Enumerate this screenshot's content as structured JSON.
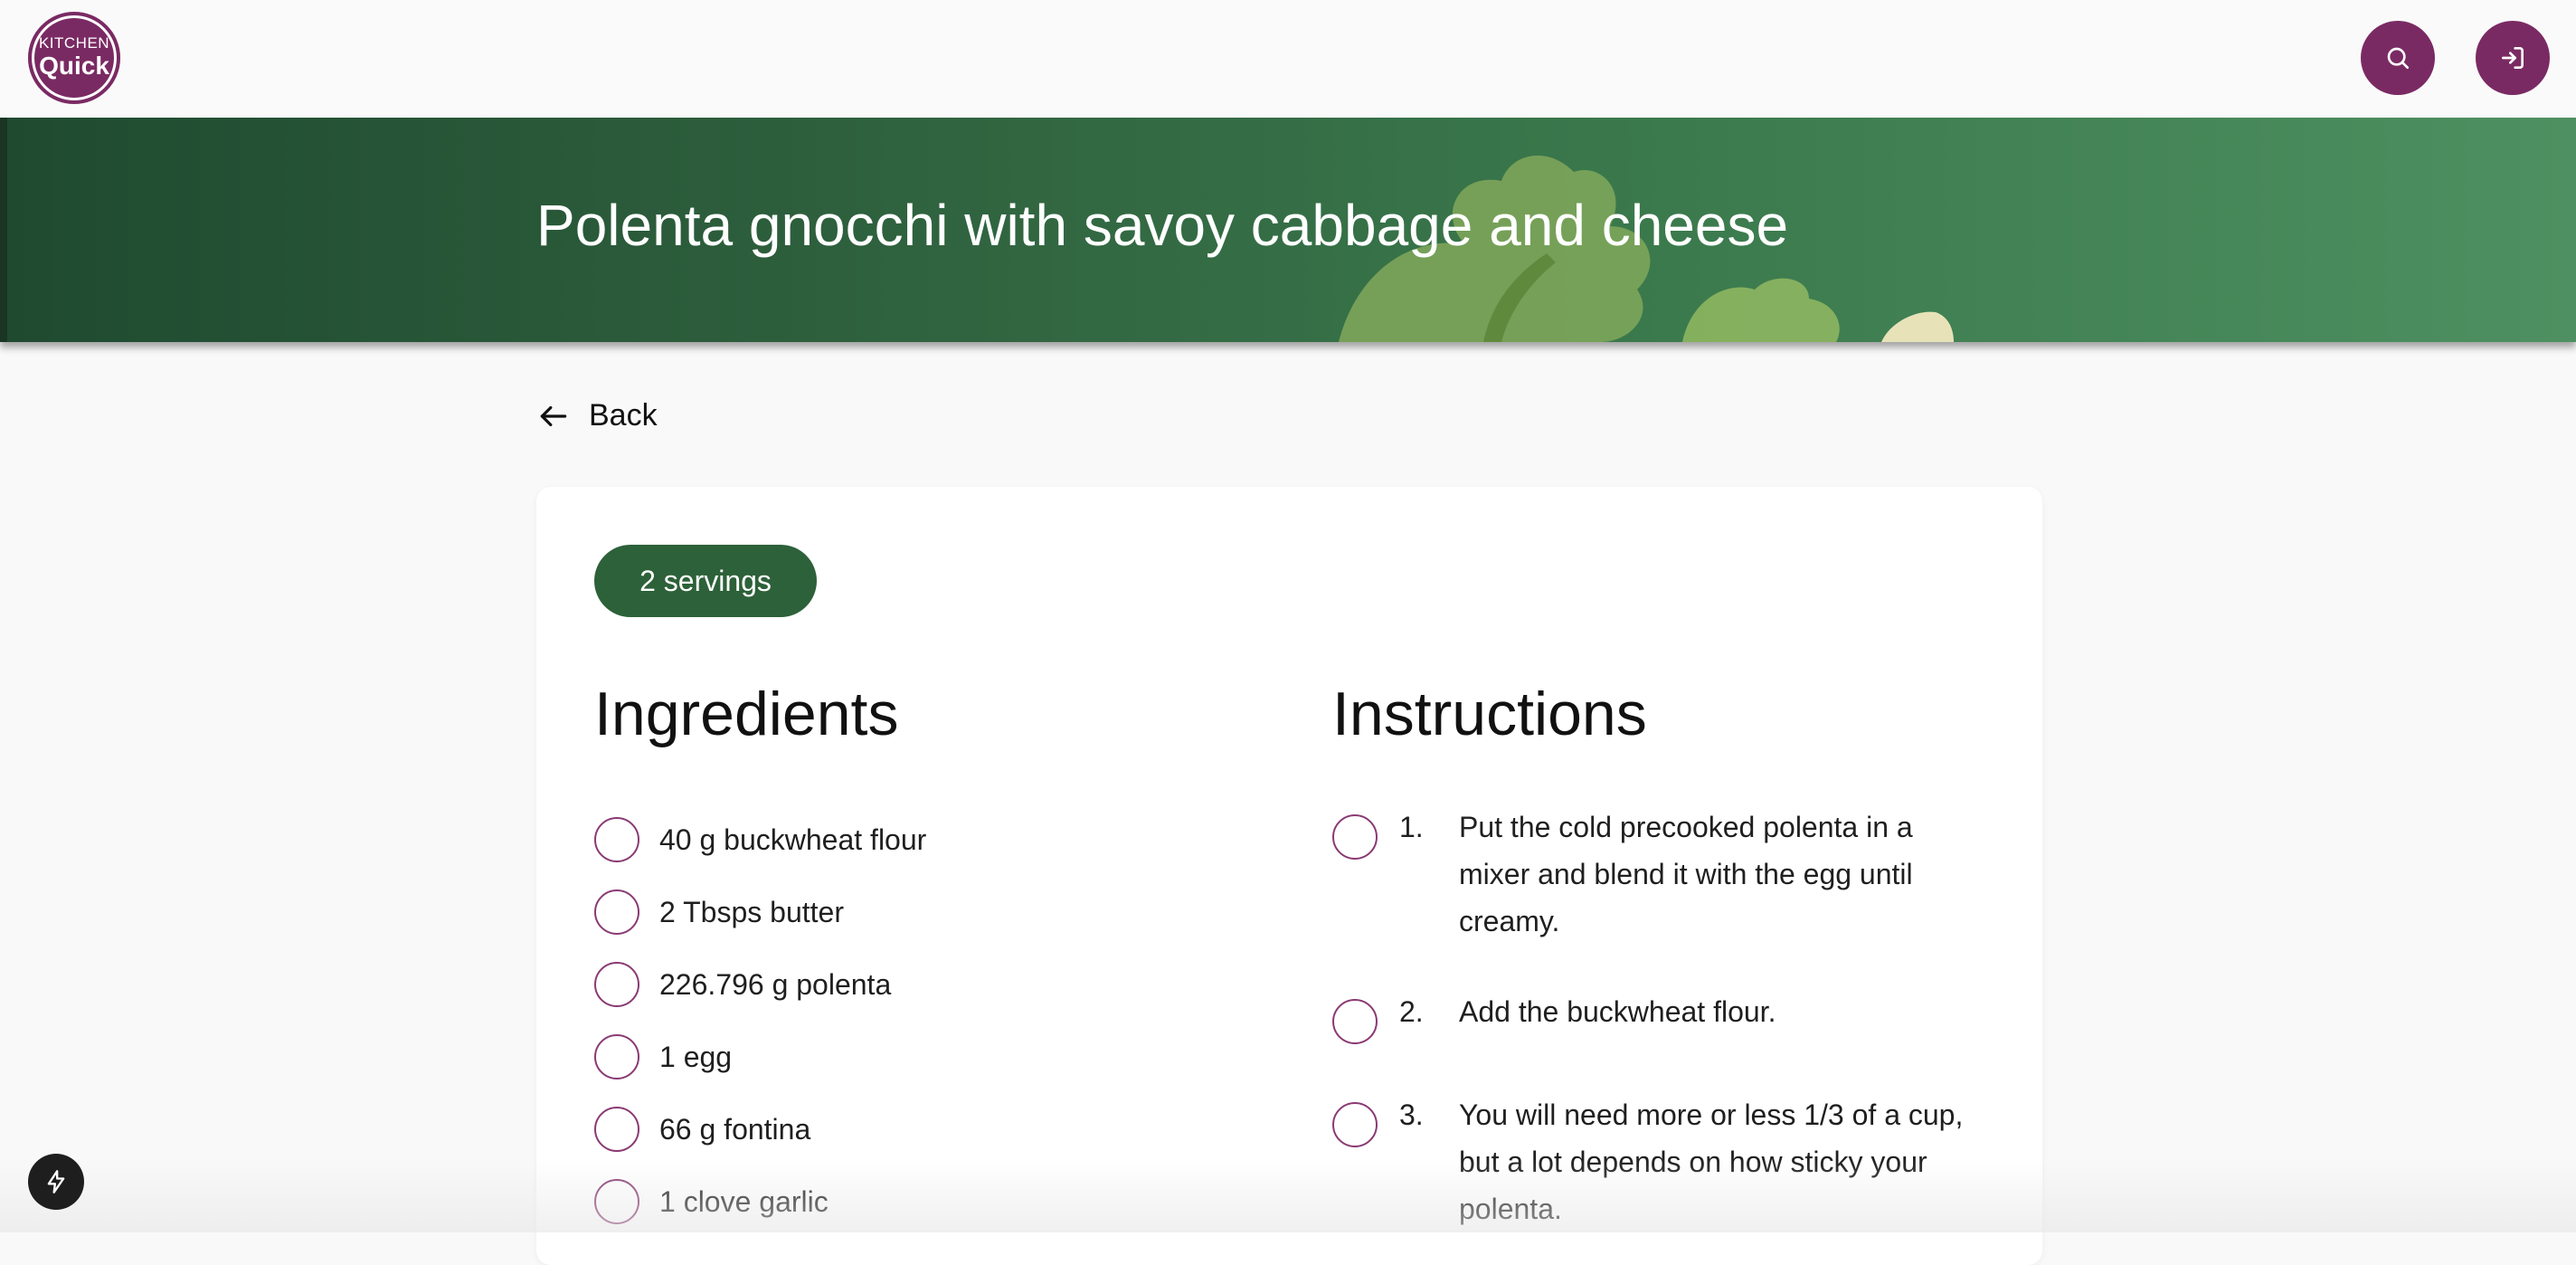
{
  "logo": {
    "line1": "KITCHEN",
    "line2": "Quick"
  },
  "header": {
    "search_icon": "search-icon",
    "login_icon": "login-icon"
  },
  "hero": {
    "title": "Polenta gnocchi with savoy cabbage and cheese"
  },
  "back": {
    "label": "Back",
    "icon": "arrow-left-icon"
  },
  "servings": {
    "label": "2 servings"
  },
  "ingredients": {
    "title": "Ingredients",
    "items": [
      "40 g buckwheat flour",
      "2 Tbsps butter",
      "226.796 g polenta",
      "1 egg",
      "66 g fontina",
      "1 clove garlic"
    ]
  },
  "instructions": {
    "title": "Instructions",
    "steps": [
      {
        "num": "1.",
        "text": "Put the cold precooked polenta in a mixer and blend it with the egg until creamy."
      },
      {
        "num": "2.",
        "text": "Add the buckwheat flour."
      },
      {
        "num": "3.",
        "text": "You will need more or less 1/3 of a cup, but a lot depends on how sticky your polenta."
      }
    ]
  },
  "colors": {
    "brand": "#7a2a63",
    "accent_green": "#2d6139"
  }
}
